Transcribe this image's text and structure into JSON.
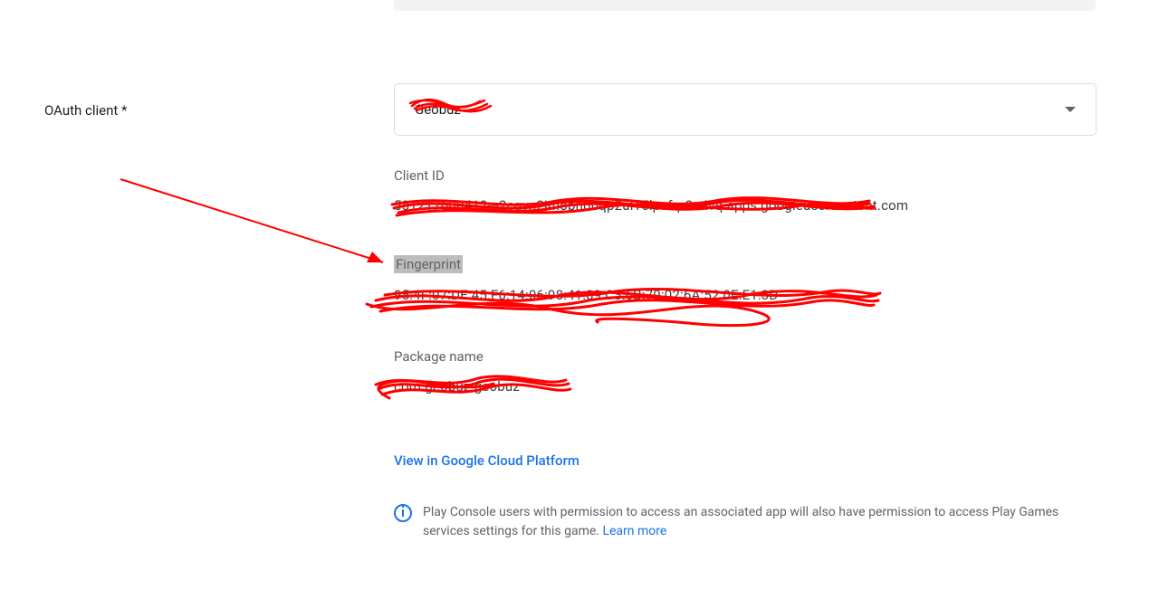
{
  "labels": {
    "oauth_client": "OAuth client  *",
    "client_id": "Client ID",
    "fingerprint": "Fingerprint",
    "package_name": "Package name"
  },
  "fields": {
    "oauth_select_value": "Geobuz",
    "client_id_value": "581217600412-e2cqvn2jmobh0bqp2ul15lpcfqr2n4vq.apps.googleusercontent.com",
    "fingerprint_value": "95:4F:07:DE:45:F6:14:06:98:41:09:C3:6B:79:02:6A:52:0E:E1:3D",
    "package_name_value": "com.geobuz.geobuz"
  },
  "links": {
    "gcp": "View in Google Cloud Platform",
    "learn_more": "Learn more"
  },
  "notice_text_before": "Play Console users with permission to access an associated app will also have permission to access Play Games services settings for this game. "
}
